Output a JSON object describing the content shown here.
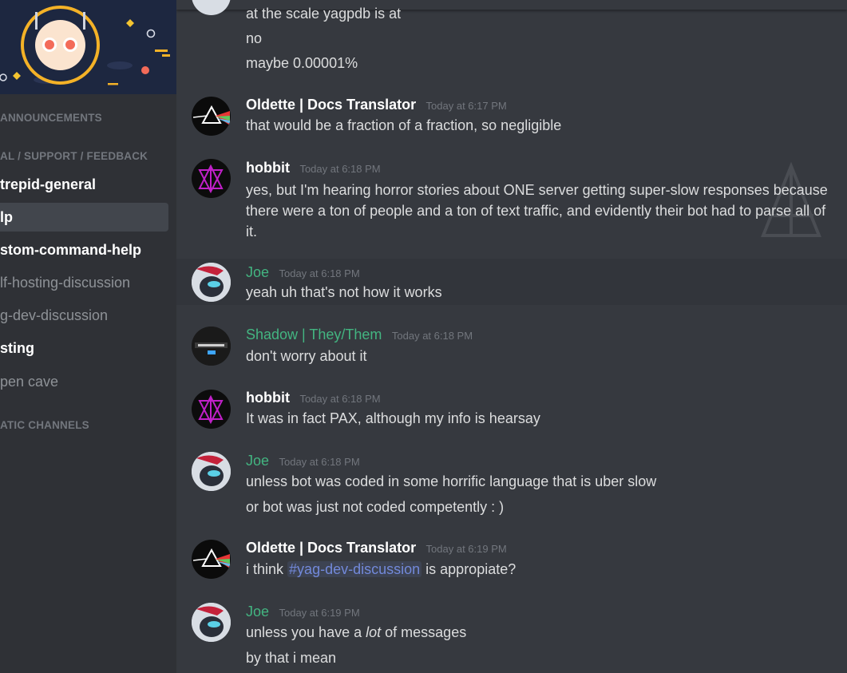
{
  "sidebar": {
    "categories": [
      "ANNOUNCEMENTS",
      "AL / SUPPORT / FEEDBACK",
      "ATIC CHANNELS"
    ],
    "channels": [
      {
        "label": "trepid-general",
        "state": "unread"
      },
      {
        "label": "lp",
        "state": "selected"
      },
      {
        "label": "stom-command-help",
        "state": "unread"
      },
      {
        "label": "lf-hosting-discussion",
        "state": "read"
      },
      {
        "label": "g-dev-discussion",
        "state": "read"
      },
      {
        "label": "sting",
        "state": "unread"
      },
      {
        "label": "pen cave",
        "state": "read"
      }
    ]
  },
  "messages": [
    {
      "lines": [
        "at the scale yagpdb is at",
        "no",
        "maybe 0.00001%"
      ]
    },
    {
      "author": "Oldette | Docs Translator",
      "time": "Today at 6:17 PM",
      "lines": [
        "that would be a fraction of a fraction, so negligible"
      ]
    },
    {
      "author": "hobbit",
      "time": "Today at 6:18 PM",
      "text": "yes, but I'm hearing horror stories about ONE server getting super-slow responses because there were a ton of people and a ton of text traffic, and evidently their bot had to parse all of it."
    },
    {
      "author": "Joe",
      "time": "Today at 6:18 PM",
      "lines": [
        "yeah uh that's not how it works"
      ]
    },
    {
      "author": "Shadow | They/Them",
      "time": "Today at 6:18 PM",
      "lines": [
        "don't worry about it"
      ]
    },
    {
      "author": "hobbit",
      "time": "Today at 6:18 PM",
      "lines": [
        "It was in fact PAX, although my info is hearsay"
      ]
    },
    {
      "author": "Joe",
      "time": "Today at 6:18 PM",
      "lines": [
        "unless bot was coded in some horrific language that is uber slow",
        "or bot was just not coded competently : )"
      ]
    },
    {
      "author": "Oldette | Docs Translator",
      "time": "Today at 6:19 PM",
      "pre": "i think",
      "mention": "#yag-dev-discussion",
      "post": "is appropiate?"
    },
    {
      "author": "Joe",
      "time": "Today at 6:19 PM",
      "pre": "unless you have a",
      "emph": "lot",
      "post": "of messages",
      "lines": [
        "by that i mean"
      ]
    }
  ],
  "colors": {
    "background": "#36393f",
    "sidebar": "#2f3136",
    "username_green": "#43b581",
    "mention": "#7289da",
    "timestamp": "#72767d"
  }
}
